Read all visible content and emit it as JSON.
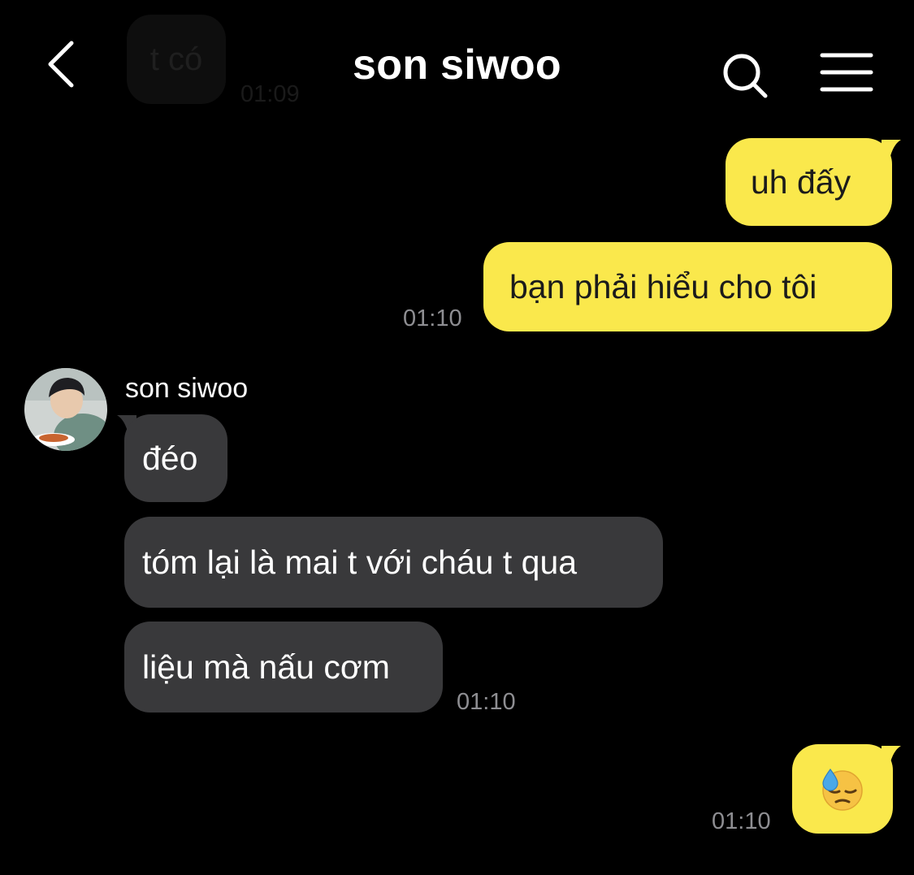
{
  "header": {
    "title": "son siwoo",
    "back_icon": "chevron-left-icon",
    "search_icon": "search-icon",
    "menu_icon": "menu-icon"
  },
  "previous": {
    "text": "t có",
    "time": "01:09"
  },
  "messages": [
    {
      "direction": "out",
      "text": "uh đấy"
    },
    {
      "direction": "out",
      "text": "bạn phải hiểu cho tôi",
      "time": "01:10"
    },
    {
      "direction": "in",
      "sender": "son siwoo",
      "text": "đéo"
    },
    {
      "direction": "in",
      "text": "tóm lại là mai t với cháu t qua"
    },
    {
      "direction": "in",
      "text": "liệu mà nấu cơm",
      "time": "01:10"
    },
    {
      "direction": "out",
      "emoji": "downcast-face-with-sweat",
      "time": "01:10"
    }
  ],
  "colors": {
    "background": "#000000",
    "outgoing_bubble": "#fae84c",
    "incoming_bubble": "#39393b",
    "timestamp": "#8e8e92"
  }
}
